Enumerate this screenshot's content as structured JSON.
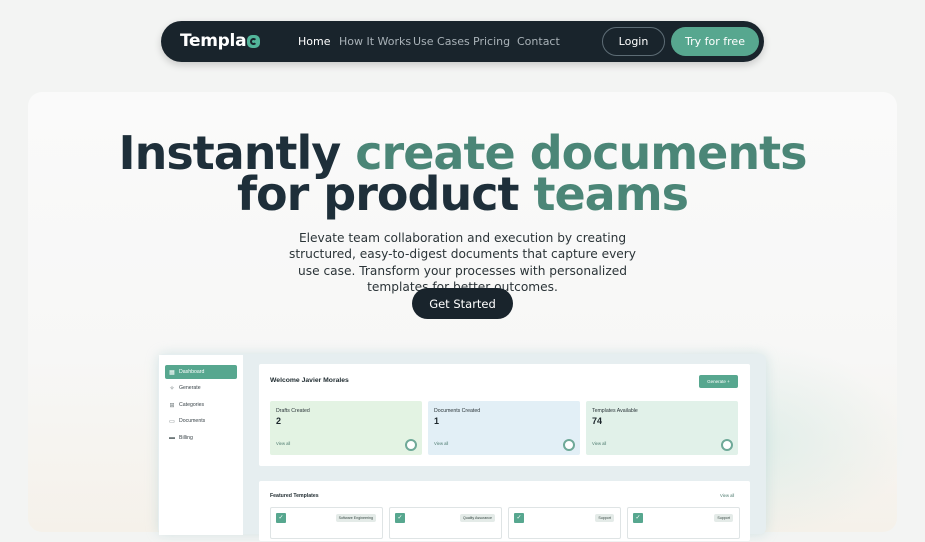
{
  "nav": {
    "logo_text": "Templa",
    "links": [
      "Home",
      "How It Works",
      "Use Cases",
      "Pricing",
      "Contact"
    ],
    "login": "Login",
    "try_free": "Try for free"
  },
  "hero": {
    "headline_word1": "Instantly",
    "headline_word2": "create",
    "headline_word3": "documents",
    "headline_word4": "for",
    "headline_word5": "product",
    "headline_word6": "teams",
    "subtitle": "Elevate team collaboration and execution by creating structured, easy-to-digest documents that capture every use case. Transform your processes with personalized templates for better outcomes.",
    "cta": "Get Started"
  },
  "dashboard": {
    "sidebar": [
      {
        "label": "Dashboard",
        "icon": "grid-icon"
      },
      {
        "label": "Generate",
        "icon": "sparkle-icon"
      },
      {
        "label": "Categories",
        "icon": "category-icon"
      },
      {
        "label": "Documents",
        "icon": "folder-icon"
      },
      {
        "label": "Billing",
        "icon": "card-icon"
      }
    ],
    "welcome": "Welcome Javier Morales",
    "generate": "Generate +",
    "stats": [
      {
        "label": "Drafts Created",
        "value": "2",
        "link": "View all"
      },
      {
        "label": "Documents Created",
        "value": "1",
        "link": "View all"
      },
      {
        "label": "Templates Available",
        "value": "74",
        "link": "View all"
      }
    ],
    "featured_title": "Featured Templates",
    "featured_viewall": "View all",
    "cards": [
      {
        "tag": "Software Engineering"
      },
      {
        "tag": "Quality Assurance"
      },
      {
        "tag": "Support"
      },
      {
        "tag": "Support"
      }
    ]
  },
  "colors": {
    "nav_bg": "#19242c",
    "accent": "#57a78f",
    "headline_dark": "#1e2f3a",
    "headline_accent": "#4b8677"
  }
}
